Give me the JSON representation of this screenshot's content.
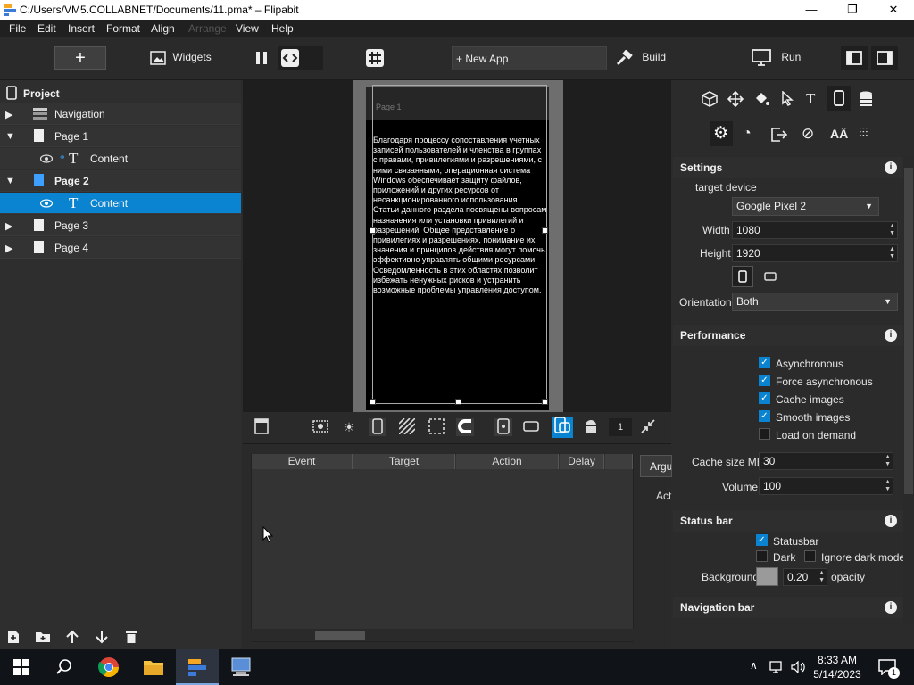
{
  "window": {
    "title": "C:/Users/VM5.COLLABNET/Documents/11.pma* – Flipabit",
    "minimize": "—",
    "maximize": "❐",
    "close": "✕"
  },
  "menu": [
    "File",
    "Edit",
    "Insert",
    "Format",
    "Align",
    "Arrange",
    "View",
    "Help"
  ],
  "toolbar": {
    "add": "+",
    "widgets": "Widgets",
    "new_app": "+ New App",
    "build": "Build",
    "run": "Run"
  },
  "project": {
    "title": "Project",
    "items": [
      {
        "label": "Navigation"
      },
      {
        "label": "Page 1"
      },
      {
        "label": "Content"
      },
      {
        "label": "Page 2"
      },
      {
        "label": "Content"
      },
      {
        "label": "Page 3"
      },
      {
        "label": "Page 4"
      }
    ]
  },
  "canvas": {
    "page_label": "Page 1",
    "content_text": "Благодаря процессу сопоставления учетных записей пользователей и членства в группах с правами, привилегиями и разрешениями, с ними связанными, операционная система Windows обеспечивает защиту файлов, приложений и других ресурсов от несанкционированного использования. Статьи данного раздела посвящены вопросам назначения или установки привилегий и разрешений. Общее представление о привилегиях и разрешениях, понимание их значения и принципов действия могут помочь эффективно управлять общими ресурсами. Осведомленность в этих областях позволит избежать ненужных рисков и устранить возможные проблемы управления доступом.",
    "zoom_value": "1"
  },
  "events": {
    "columns": [
      "Event",
      "Target",
      "Action",
      "Delay"
    ],
    "tab_label": "Argu",
    "act_label": "Act"
  },
  "settings": {
    "title": "Settings",
    "target_device_label": "target device",
    "target_device": "Google Pixel 2",
    "width_label": "Width",
    "width": "1080",
    "height_label": "Height",
    "height": "1920",
    "orientation_label": "Orientation",
    "orientation": "Both"
  },
  "performance": {
    "title": "Performance",
    "options": [
      {
        "label": "Asynchronous",
        "checked": true
      },
      {
        "label": "Force asynchronous",
        "checked": true
      },
      {
        "label": "Cache images",
        "checked": true
      },
      {
        "label": "Smooth images",
        "checked": true
      },
      {
        "label": "Load on demand",
        "checked": false
      }
    ],
    "cache_size_label": "Cache size MB",
    "cache_size": "30",
    "volume_label": "Volume",
    "volume": "100"
  },
  "status_bar": {
    "title": "Status bar",
    "statusbar_label": "Statusbar",
    "dark_label": "Dark",
    "ignore_dark_label": "Ignore dark mode",
    "background_label": "Background",
    "opacity_value": "0.20",
    "opacity_label": "opacity",
    "bg_color": "#9a9a9a"
  },
  "navigation_bar": {
    "title": "Navigation bar"
  },
  "taskbar": {
    "time": "8:33 AM",
    "date": "5/14/2023",
    "notif_count": "1"
  },
  "colors": {
    "accent": "#0a84d0",
    "background": "#2b2b2b"
  }
}
